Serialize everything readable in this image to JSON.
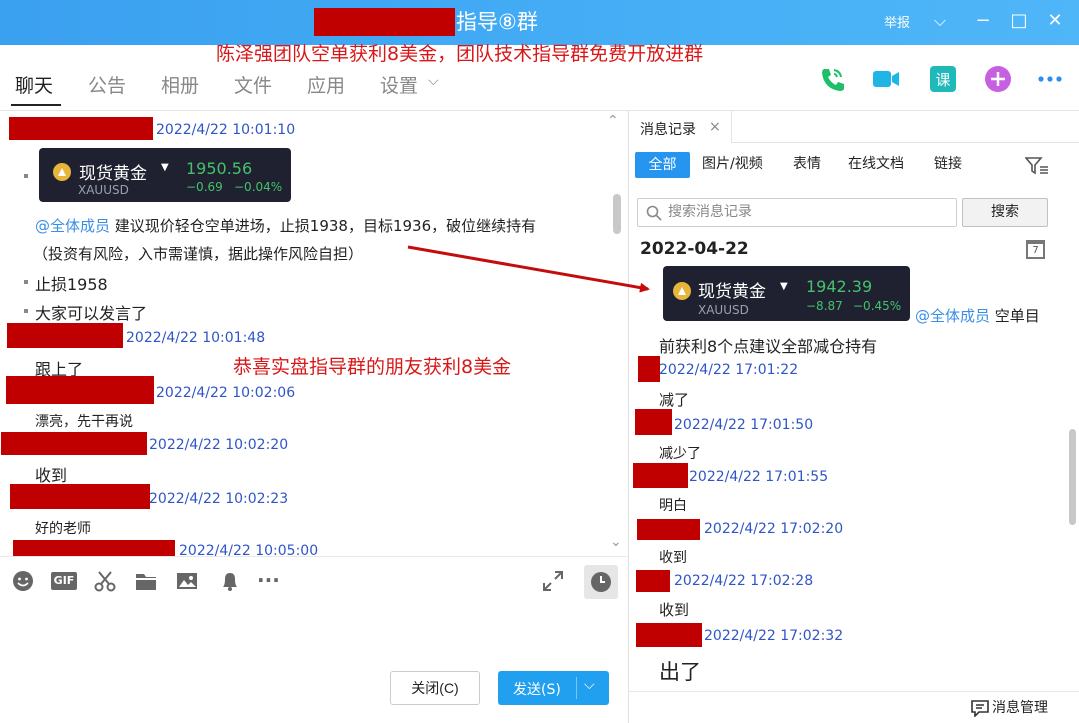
{
  "window": {
    "title": "指导⑧群",
    "report": "举报",
    "minimize_icon": "−",
    "maximize_icon": "□",
    "close_icon": "✕",
    "dropdown_icon": "⌵"
  },
  "promo": "陈泽强团队空单获利8美金，团队技术指导群免费开放进群",
  "tabs": [
    "聊天",
    "公告",
    "相册",
    "文件",
    "应用",
    "设置"
  ],
  "tab_settings_caret": "⌵",
  "colors": {
    "accent": "#2695f0",
    "redact": "#c00000",
    "timestamp": "#2f55c8",
    "annotation": "#d81818",
    "up": "#43c26b"
  },
  "chat": {
    "messages": [
      {
        "time": "2022/4/22 10:01:10"
      },
      {
        "ticker": {
          "name": "现货黄金",
          "symbol": "XAUUSD",
          "price": "1950.56",
          "change": "−0.69",
          "change_pct": "−0.04%"
        }
      },
      {
        "mention": "@全体成员",
        "text": "建议现价轻仓空单进场，止损1938，目标1936，破位继续持有"
      },
      {
        "text": "（投资有风险，入市需谨慎，据此操作风险自担）"
      },
      {
        "text": "止损1958"
      },
      {
        "text": "大家可以发言了"
      },
      {
        "time": "2022/4/22 10:01:48"
      },
      {
        "text": "跟上了"
      },
      {
        "time": "2022/4/22 10:02:06"
      },
      {
        "text": "漂亮，先干再说"
      },
      {
        "time": "2022/4/22 10:02:20"
      },
      {
        "text": "收到"
      },
      {
        "time": "2022/4/22 10:02:23"
      },
      {
        "text": "好的老师"
      },
      {
        "time": "2022/4/22 10:05:00"
      }
    ],
    "annotation": "恭喜实盘指导群的朋友获利8美金"
  },
  "toolbar": {
    "icons": [
      "emoji-icon",
      "gif-icon",
      "scissors-icon",
      "folder-icon",
      "image-icon",
      "bell-icon",
      "more-icon"
    ],
    "gif_label": "GIF",
    "more_label": "···",
    "close_label": "关闭(C)",
    "send_label": "发送(S)",
    "send_caret": "⌵"
  },
  "right_panel": {
    "tab_label": "消息记录",
    "tab_close": "×",
    "filters": [
      "全部",
      "图片/视频",
      "表情",
      "在线文档",
      "链接"
    ],
    "search_placeholder": "搜索消息记录",
    "search_button": "搜索",
    "date": "2022-04-22",
    "calendar_day": "7",
    "ticker": {
      "name": "现货黄金",
      "symbol": "XAUUSD",
      "price": "1942.39",
      "change": "−8.87",
      "change_pct": "−0.45%"
    },
    "mention": "@全体成员",
    "mention_text": "空单目",
    "line2": "前获利8个点建议全部减仓持有",
    "records": [
      {
        "time": "2022/4/22 17:01:22",
        "text": "减了"
      },
      {
        "time": "2022/4/22 17:01:50",
        "text": "减少了"
      },
      {
        "time": "2022/4/22 17:01:55",
        "text": "明白"
      },
      {
        "time": "2022/4/22 17:02:20",
        "text": "收到"
      },
      {
        "time": "2022/4/22 17:02:28",
        "text": "收到"
      },
      {
        "time": "2022/4/22 17:02:32",
        "text": "出了"
      }
    ],
    "manage_label": "消息管理"
  }
}
